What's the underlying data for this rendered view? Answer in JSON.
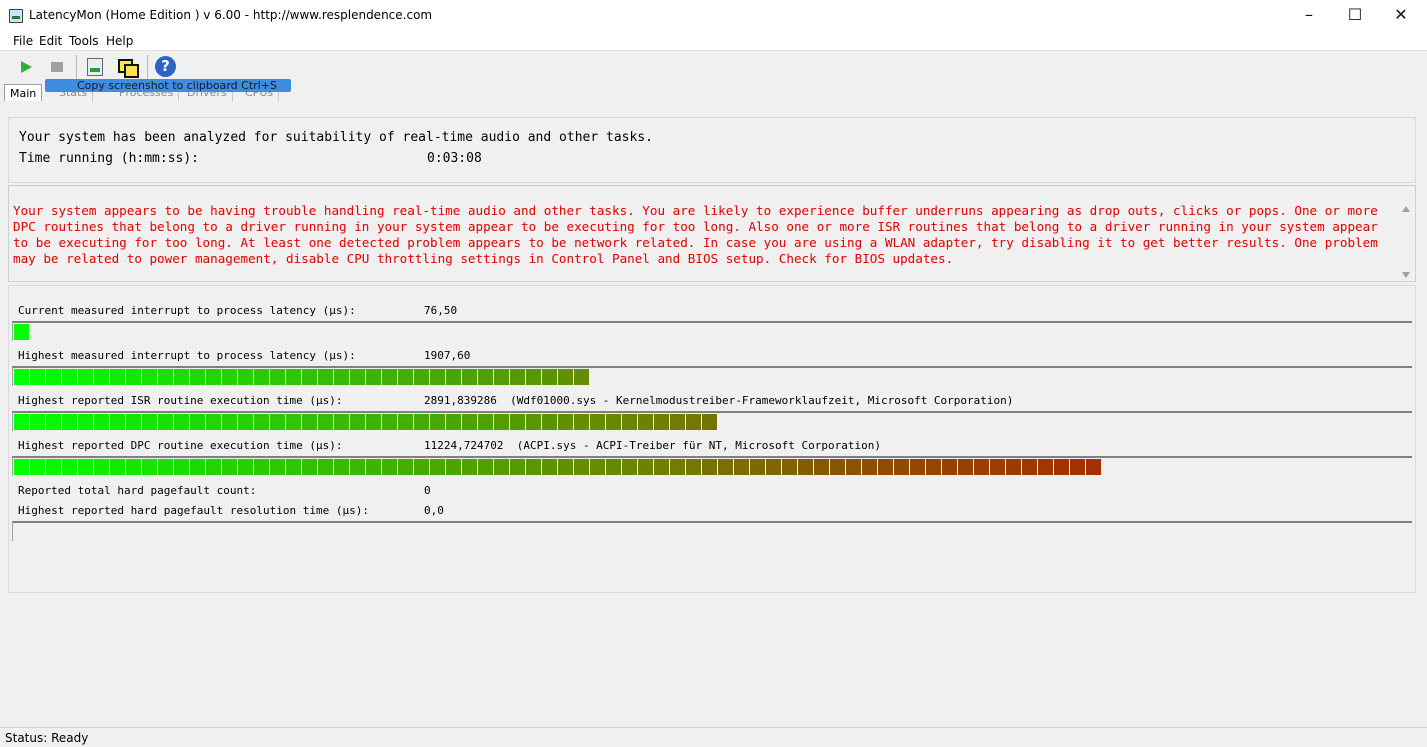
{
  "window": {
    "title": "LatencyMon  (Home Edition )  v 6.00 - http://www.resplendence.com",
    "minimize": "–",
    "maximize": "☐",
    "close": "✕"
  },
  "menu": [
    "File",
    "Edit",
    "Tools",
    "Help"
  ],
  "toolbar": {
    "icons": [
      "play-icon",
      "stop-icon",
      "report-icon",
      "copy-screenshot-icon",
      "help-icon"
    ],
    "tooltip": "Copy screenshot to clipboard  Ctrl+S"
  },
  "tabs": {
    "active": "Main",
    "others": [
      "Stats",
      "Processes",
      "Drivers",
      "CPUs"
    ]
  },
  "summary": {
    "line1": "Your system has been analyzed for suitability of real-time audio and other tasks.",
    "time_label": "Time running (h:mm:ss):",
    "time_value": "0:03:08"
  },
  "warning": {
    "text": "Your system appears to be having trouble handling real-time audio and other tasks. You are likely to experience buffer underruns appearing as drop outs, clicks or pops. One or more DPC routines that belong to a driver running in your system appear to be executing for too long. Also one or more ISR routines that belong to a driver running in your system appear to be executing for too long. At least one detected problem appears to be network related. In case you are using a WLAN adapter, try disabling it to get better results. One problem may be related to power management, disable CPU throttling settings in Control Panel and BIOS setup. Check for BIOS updates.",
    "color": "#e00000"
  },
  "metrics": {
    "current_latency": {
      "label": "Current measured interrupt to process latency (µs):",
      "value": "76,50",
      "fill": 0.022
    },
    "highest_latency": {
      "label": "Highest measured interrupt to process latency (µs):",
      "value": "1907,60",
      "fill": 0.422
    },
    "highest_isr": {
      "label": "Highest reported ISR routine execution time (µs):",
      "value": "2891,839286  (Wdf01000.sys - Kernelmodustreiber-Frameworklaufzeit, Microsoft Corporation)",
      "fill": 0.514
    },
    "highest_dpc": {
      "label": "Highest reported DPC routine execution time (µs):",
      "value": "11224,724702  (ACPI.sys - ACPI-Treiber für NT, Microsoft Corporation)",
      "fill": 0.789
    },
    "pagefault_count": {
      "label": "Reported total hard pagefault count:",
      "value": "0"
    },
    "pagefault_time": {
      "label": "Highest reported hard pagefault resolution time (µs):",
      "value": "0,0",
      "fill": 0.0
    }
  },
  "status": {
    "text": "Status: Ready"
  }
}
